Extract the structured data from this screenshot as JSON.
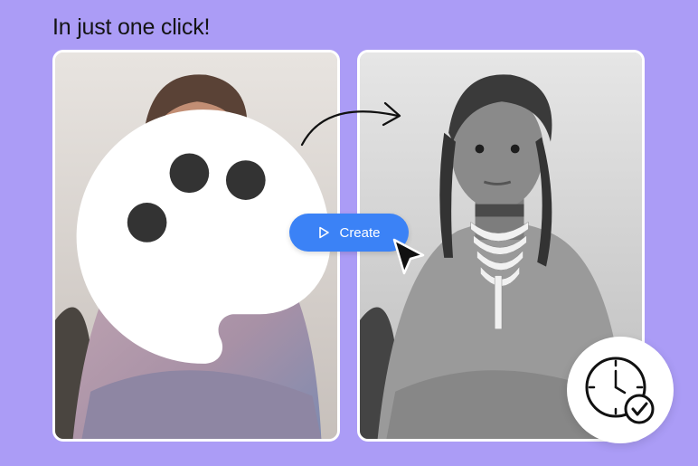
{
  "headline": "In just one click!",
  "create_button": {
    "label": "Create",
    "icon": "play-icon",
    "color": "#3b82f6"
  },
  "background_color": "#ab9cf6",
  "images": {
    "colorized": {
      "tone": "color",
      "icon": "palette-icon"
    },
    "original": {
      "tone": "grayscale"
    }
  },
  "badge": {
    "icon": "clock-check-icon"
  }
}
